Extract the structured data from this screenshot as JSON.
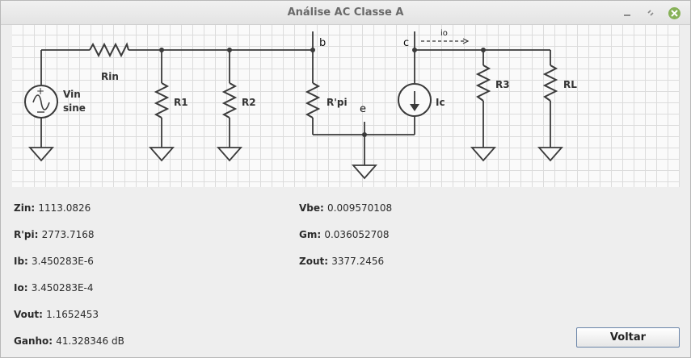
{
  "window": {
    "title": "Análise AC Classe A"
  },
  "schematic": {
    "labels": {
      "rin": "Rin",
      "vin": "Vin",
      "vin_type": "sine",
      "r1": "R1",
      "r2": "R2",
      "rpi": "R'pi",
      "node_b": "b",
      "node_e": "e",
      "node_c": "c",
      "io": "io",
      "ic": "Ic",
      "r3": "R3",
      "rl": "RL"
    }
  },
  "results": {
    "zin": {
      "label": "Zin:",
      "value": "1113.0826"
    },
    "rpi": {
      "label": "R'pi:",
      "value": "2773.7168"
    },
    "ib": {
      "label": "Ib:",
      "value": "3.450283E-6"
    },
    "io": {
      "label": "Io:",
      "value": "3.450283E-4"
    },
    "vout": {
      "label": "Vout:",
      "value": "1.1652453"
    },
    "ganho": {
      "label": "Ganho:",
      "value": "41.328346 dB"
    },
    "vbe": {
      "label": "Vbe:",
      "value": "0.009570108"
    },
    "gm": {
      "label": "Gm:",
      "value": "0.036052708"
    },
    "zout": {
      "label": "Zout:",
      "value": "3377.2456"
    }
  },
  "buttons": {
    "voltar": "Voltar"
  }
}
